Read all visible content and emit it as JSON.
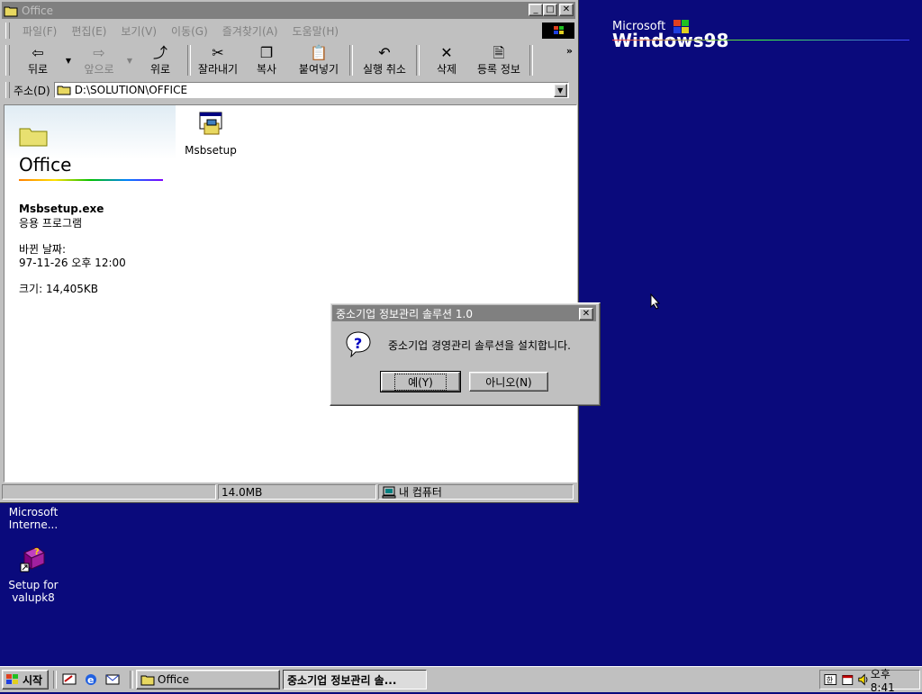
{
  "window": {
    "title": "Office",
    "menu": [
      "파일(F)",
      "편집(E)",
      "보기(V)",
      "이동(G)",
      "즐겨찾기(A)",
      "도움말(H)"
    ],
    "toolbar": {
      "back": "뒤로",
      "forward": "앞으로",
      "up": "위로",
      "cut": "잘라내기",
      "copy": "복사",
      "paste": "붙여넣기",
      "undo": "실행 취소",
      "delete": "삭제",
      "properties": "등록 정보"
    },
    "address": {
      "label": "주소(D)",
      "value": "D:\\SOLUTION\\OFFICE"
    },
    "webview": {
      "folder_title": "Office",
      "file_name": "Msbsetup.exe",
      "file_type": "응용 프로그램",
      "date_label": "바뀐 날짜:",
      "date_value": "97-11-26 오후 12:00",
      "size": "크기: 14,405KB"
    },
    "files": [
      {
        "name": "Msbsetup",
        "icon": "setup-program-icon"
      }
    ],
    "status": {
      "left": "",
      "size": "14.0MB",
      "zone": "내 컴퓨터"
    }
  },
  "desktop": {
    "logo": {
      "microsoft": "Microsoft",
      "windows": "Windows98"
    },
    "icons": [
      {
        "label_line1": "Microsoft",
        "label_line2": "Interne..."
      },
      {
        "label_line1": "Setup for",
        "label_line2": "valupk8"
      }
    ]
  },
  "dialog": {
    "title": "중소기업 정보관리 솔루션 1.0",
    "message": "중소기업 경영관리 솔루션을 설치합니다.",
    "yes": "예(Y)",
    "no": "아니오(N)"
  },
  "taskbar": {
    "start": "시작",
    "tasks": [
      "Office",
      "중소기업 정보관리 솔..."
    ],
    "clock": "오후 8:41"
  },
  "colors": {
    "desktop": "#0a0a7c",
    "face": "#c0c0c0",
    "inactive_title": "#808080"
  }
}
